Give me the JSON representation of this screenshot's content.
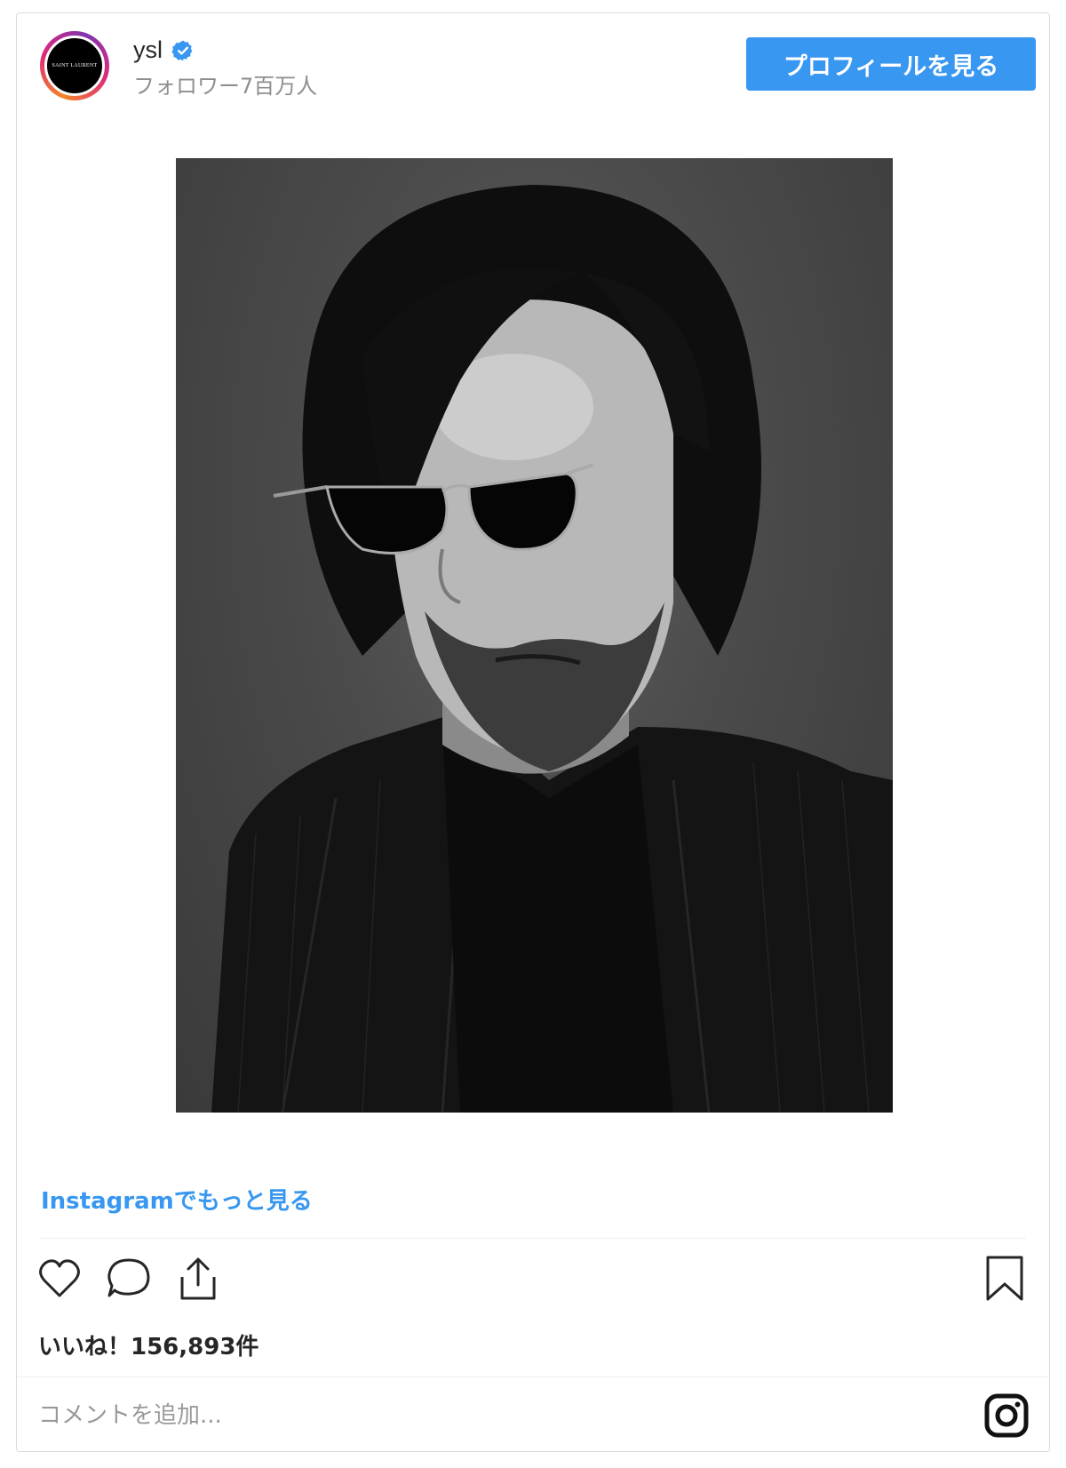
{
  "header": {
    "avatar_text": "SAINT LAURENT",
    "username": "ysl",
    "followers": "フォロワー7百万人",
    "profile_button": "プロフィールを見る"
  },
  "post": {
    "more_link": "Instagramでもっと見る",
    "likes": "いいね！156,893件",
    "comment_placeholder": "コメントを追加..."
  },
  "icons": {
    "verified": "verified-badge-icon",
    "like": "heart-icon",
    "comment": "comment-bubble-icon",
    "share": "share-icon",
    "save": "bookmark-icon",
    "instagram": "instagram-logo-icon"
  },
  "colors": {
    "accent": "#3897f0",
    "text": "#262626",
    "muted": "#8e8e8e",
    "border": "#dbdbdb"
  }
}
